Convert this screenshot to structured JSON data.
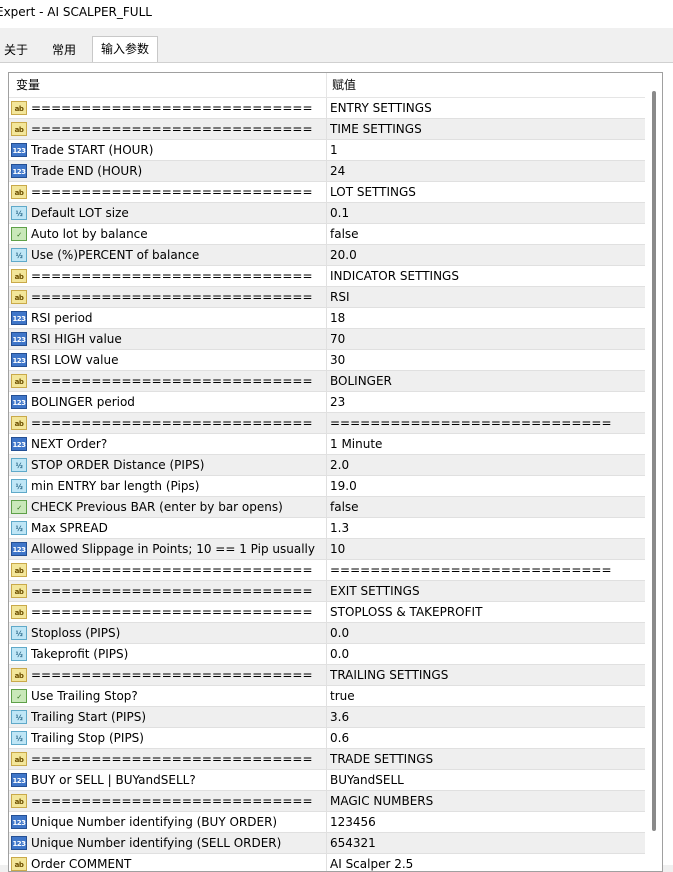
{
  "window": {
    "title": "Expert - AI SCALPER_FULL"
  },
  "tabs": [
    {
      "label": "关于"
    },
    {
      "label": "常用"
    },
    {
      "label": "输入参数"
    }
  ],
  "grid": {
    "columns": {
      "variable": "变量",
      "value": "赋值"
    },
    "rows": [
      {
        "type": "ab",
        "name": "============================",
        "value": "ENTRY SETTINGS"
      },
      {
        "type": "ab",
        "name": "============================",
        "value": "TIME SETTINGS"
      },
      {
        "type": "int",
        "name": "Trade START (HOUR)",
        "value": "1"
      },
      {
        "type": "int",
        "name": "Trade END (HOUR)",
        "value": "24"
      },
      {
        "type": "ab",
        "name": "============================",
        "value": "LOT SETTINGS"
      },
      {
        "type": "dbl",
        "name": "Default LOT size",
        "value": "0.1"
      },
      {
        "type": "bool",
        "name": "Auto lot by balance",
        "value": "false"
      },
      {
        "type": "dbl",
        "name": "Use (%)PERCENT of balance",
        "value": "20.0"
      },
      {
        "type": "ab",
        "name": "============================",
        "value": "INDICATOR SETTINGS"
      },
      {
        "type": "ab",
        "name": "============================",
        "value": "RSI"
      },
      {
        "type": "int",
        "name": "RSI period",
        "value": "18"
      },
      {
        "type": "int",
        "name": "RSI HIGH value",
        "value": "70"
      },
      {
        "type": "int",
        "name": "RSI LOW value",
        "value": "30"
      },
      {
        "type": "ab",
        "name": "============================",
        "value": "BOLINGER"
      },
      {
        "type": "int",
        "name": "BOLINGER period",
        "value": "23"
      },
      {
        "type": "ab",
        "name": "============================",
        "value": "============================"
      },
      {
        "type": "int",
        "name": "NEXT Order?",
        "value": "1 Minute"
      },
      {
        "type": "dbl",
        "name": "STOP ORDER Distance (PIPS)",
        "value": "2.0"
      },
      {
        "type": "dbl",
        "name": "min ENTRY bar length (Pips)",
        "value": "19.0"
      },
      {
        "type": "bool",
        "name": "CHECK Previous BAR (enter by bar opens)",
        "value": "false"
      },
      {
        "type": "dbl",
        "name": "Max SPREAD",
        "value": "1.3"
      },
      {
        "type": "int",
        "name": "Allowed Slippage in Points; 10 == 1 Pip usually",
        "value": "10"
      },
      {
        "type": "ab",
        "name": "============================",
        "value": "============================"
      },
      {
        "type": "ab",
        "name": "============================",
        "value": "EXIT SETTINGS"
      },
      {
        "type": "ab",
        "name": "============================",
        "value": "STOPLOSS & TAKEPROFIT"
      },
      {
        "type": "dbl",
        "name": "Stoploss (PIPS)",
        "value": "0.0"
      },
      {
        "type": "dbl",
        "name": "Takeprofit (PIPS)",
        "value": "0.0"
      },
      {
        "type": "ab",
        "name": "============================",
        "value": "TRAILING SETTINGS"
      },
      {
        "type": "bool",
        "name": "Use Trailing Stop?",
        "value": "true"
      },
      {
        "type": "dbl",
        "name": "Trailing Start (PIPS)",
        "value": "3.6"
      },
      {
        "type": "dbl",
        "name": "Trailing Stop (PIPS)",
        "value": "0.6"
      },
      {
        "type": "ab",
        "name": "============================",
        "value": "TRADE SETTINGS"
      },
      {
        "type": "int",
        "name": "BUY or SELL | BUYandSELL?",
        "value": "BUYandSELL"
      },
      {
        "type": "ab",
        "name": "============================",
        "value": "MAGIC NUMBERS"
      },
      {
        "type": "int",
        "name": "Unique Number identifying (BUY ORDER)",
        "value": "123456"
      },
      {
        "type": "int",
        "name": "Unique Number identifying (SELL ORDER)",
        "value": "654321"
      },
      {
        "type": "ab",
        "name": "Order COMMENT",
        "value": "AI Scalper 2.5"
      }
    ]
  },
  "icons": {
    "ab": {
      "icon": "string-type-icon",
      "glyph": "ab"
    },
    "int": {
      "icon": "integer-type-icon",
      "glyph": "123"
    },
    "dbl": {
      "icon": "double-type-icon",
      "glyph": "½"
    },
    "bool": {
      "icon": "boolean-type-icon",
      "glyph": "✓"
    }
  }
}
